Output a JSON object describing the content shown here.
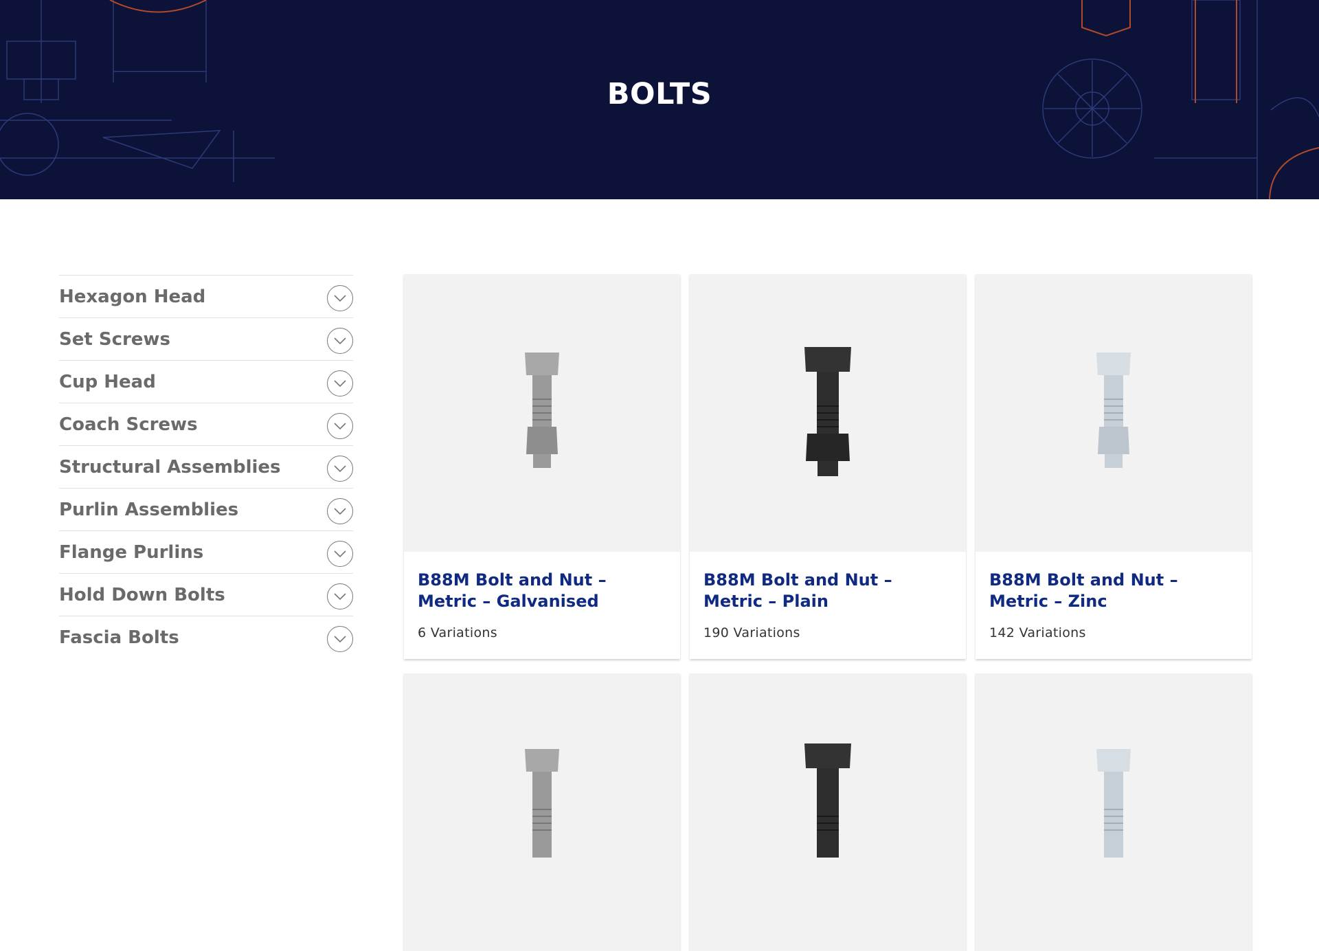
{
  "hero": {
    "title": "BOLTS"
  },
  "sidebar": {
    "items": [
      {
        "label": "Hexagon Head",
        "icon": "chevron-down-icon"
      },
      {
        "label": "Set Screws",
        "icon": "chevron-down-icon"
      },
      {
        "label": "Cup Head",
        "icon": "chevron-down-icon"
      },
      {
        "label": "Coach Screws",
        "icon": "chevron-down-icon"
      },
      {
        "label": "Structural Assemblies",
        "icon": "chevron-down-icon"
      },
      {
        "label": "Purlin Assemblies",
        "icon": "chevron-down-icon"
      },
      {
        "label": "Flange Purlins",
        "icon": "chevron-down-icon"
      },
      {
        "label": "Hold Down Bolts",
        "icon": "chevron-down-icon"
      },
      {
        "label": "Fascia Bolts",
        "icon": "chevron-down-icon"
      }
    ]
  },
  "products": [
    {
      "title": "B88M Bolt and Nut – Metric – Galvanised",
      "variations": "6 Variations",
      "finish": "galvanised"
    },
    {
      "title": "B88M Bolt and Nut – Metric – Plain",
      "variations": "190 Variations",
      "finish": "plain"
    },
    {
      "title": "B88M Bolt and Nut – Metric – Zinc",
      "variations": "142 Variations",
      "finish": "zinc"
    },
    {
      "title": "",
      "variations": "",
      "finish": "galvanised"
    },
    {
      "title": "",
      "variations": "",
      "finish": "plain"
    },
    {
      "title": "",
      "variations": "",
      "finish": "zinc"
    }
  ],
  "colors": {
    "hero_bg": "#0d1238",
    "title_blue": "#0f2a80",
    "blueprint_line": "#2b3a78",
    "blueprint_accent": "#b04a2a",
    "galvanised": "#9a9a9a",
    "plain": "#2e2e2e",
    "zinc": "#c7cfd6"
  }
}
